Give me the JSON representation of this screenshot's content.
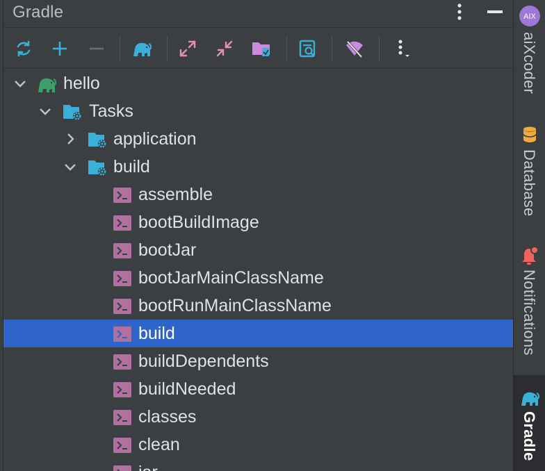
{
  "panel": {
    "title": "Gradle",
    "toolbar": {
      "icons": [
        "refresh-icon",
        "plus-icon",
        "minus-icon",
        "elephant-icon",
        "expand-all-icon",
        "collapse-all-icon",
        "folder-icon",
        "analyze-icon",
        "offline-mode-icon",
        "more-vertical-icon"
      ]
    }
  },
  "tree": {
    "items": [
      {
        "label": "hello",
        "kind": "project"
      },
      {
        "label": "Tasks",
        "kind": "folder"
      },
      {
        "label": "application",
        "kind": "folder"
      },
      {
        "label": "build",
        "kind": "folder"
      },
      {
        "label": "assemble",
        "kind": "task"
      },
      {
        "label": "bootBuildImage",
        "kind": "task"
      },
      {
        "label": "bootJar",
        "kind": "task"
      },
      {
        "label": "bootJarMainClassName",
        "kind": "task"
      },
      {
        "label": "bootRunMainClassName",
        "kind": "task"
      },
      {
        "label": "build",
        "kind": "task",
        "selected": true
      },
      {
        "label": "buildDependents",
        "kind": "task"
      },
      {
        "label": "buildNeeded",
        "kind": "task"
      },
      {
        "label": "classes",
        "kind": "task"
      },
      {
        "label": "clean",
        "kind": "task"
      },
      {
        "label": "jar",
        "kind": "task"
      }
    ]
  },
  "right_stripe": {
    "items": [
      {
        "label": "aiXcoder",
        "icon": "aixcoder-icon"
      },
      {
        "label": "Database",
        "icon": "database-icon"
      },
      {
        "label": "Notifications",
        "icon": "bell-icon"
      },
      {
        "label": "Gradle",
        "icon": "elephant-icon",
        "active": true
      }
    ]
  },
  "colors": {
    "panel_bg": "#3c3f41",
    "selection": "#2f65ca",
    "accent_blue": "#3ab0d8",
    "gradle_green": "#3aa16a",
    "task_purple": "#b070a0"
  }
}
